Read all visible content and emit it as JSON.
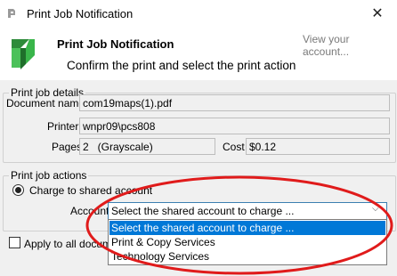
{
  "window": {
    "title": "Print Job Notification",
    "close_glyph": "✕"
  },
  "header": {
    "title": "Print Job Notification",
    "subtitle": "Confirm the print and select the print action",
    "view_account": "View your account..."
  },
  "details": {
    "legend": "Print job details",
    "document_name_label": "Document name",
    "document_name": "com19maps(1).pdf",
    "printer_label": "Printer",
    "printer": "wnpr09\\pcs808",
    "pages_label": "Pages",
    "pages": "2   (Grayscale)",
    "cost_label": "Cost",
    "cost": "$0.12"
  },
  "actions": {
    "legend": "Print job actions",
    "radio_label": "Charge to shared account",
    "radio_checked": true,
    "account_label": "Account",
    "account_selected": "Select the shared account to charge ...",
    "options": [
      "Select the shared account to charge ...",
      "Print & Copy Services",
      "Technology Services"
    ],
    "apply_all_label": "Apply to all documents"
  },
  "colors": {
    "selection": "#0078d7",
    "annotation": "#e01b1b",
    "logo_green": "#39b54a"
  }
}
